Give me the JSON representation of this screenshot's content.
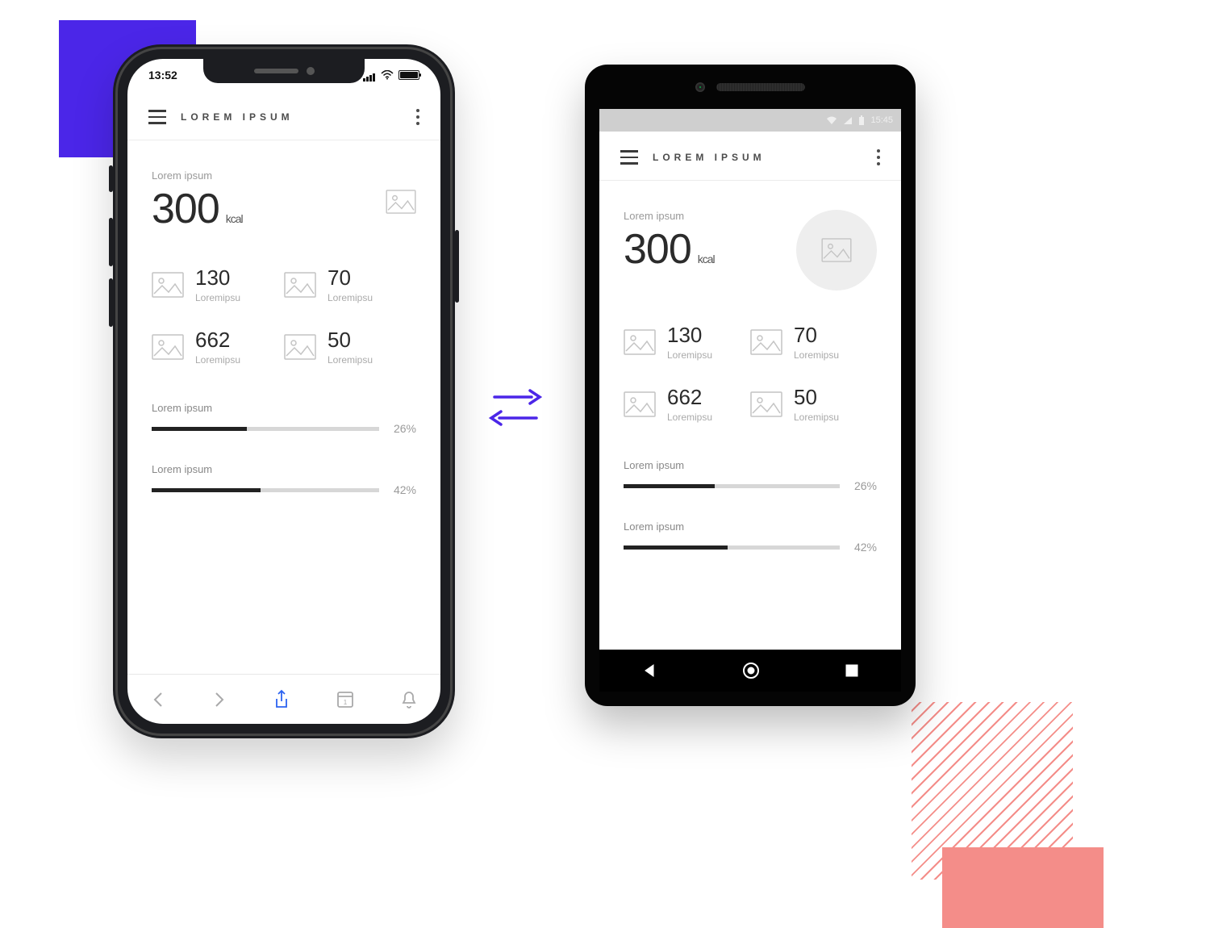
{
  "appTitle": "LOREM IPSUM",
  "ios": {
    "time": "13:52"
  },
  "android": {
    "time": "15:45"
  },
  "hero": {
    "label": "Lorem ipsum",
    "value": "300",
    "unit": "kcal"
  },
  "stats": [
    {
      "value": "130",
      "label": "Loremipsu"
    },
    {
      "value": "70",
      "label": "Loremipsu"
    },
    {
      "value": "662",
      "label": "Loremipsu"
    },
    {
      "value": "50",
      "label": "Loremipsu"
    }
  ],
  "bars": [
    {
      "label": "Lorem ipsum",
      "pct": "26%",
      "fill": 42
    },
    {
      "label": "Lorem ipsum",
      "pct": "42%",
      "fill": 48
    }
  ]
}
